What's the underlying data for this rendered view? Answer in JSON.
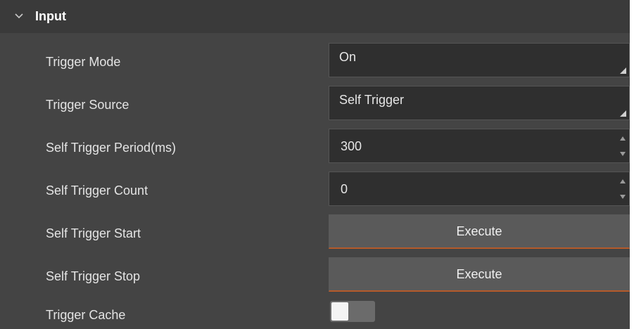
{
  "section": {
    "title": "Input",
    "expanded": true,
    "chevron_icon": "chevron-down-icon"
  },
  "fields": {
    "trigger_mode": {
      "label": "Trigger Mode",
      "value": "On"
    },
    "trigger_source": {
      "label": "Trigger Source",
      "value": "Self Trigger"
    },
    "self_trigger_period": {
      "label": "Self Trigger Period(ms)",
      "value": "300"
    },
    "self_trigger_count": {
      "label": "Self Trigger Count",
      "value": "0"
    },
    "self_trigger_start": {
      "label": "Self Trigger Start",
      "button": "Execute"
    },
    "self_trigger_stop": {
      "label": "Self Trigger Stop",
      "button": "Execute"
    },
    "trigger_cache": {
      "label": "Trigger Cache",
      "enabled": false
    }
  },
  "colors": {
    "panel_bg": "#444444",
    "header_bg": "#3a3a3a",
    "input_bg": "#2f2f2f",
    "button_bg": "#5a5a5a",
    "button_accent": "#b55a2a"
  }
}
